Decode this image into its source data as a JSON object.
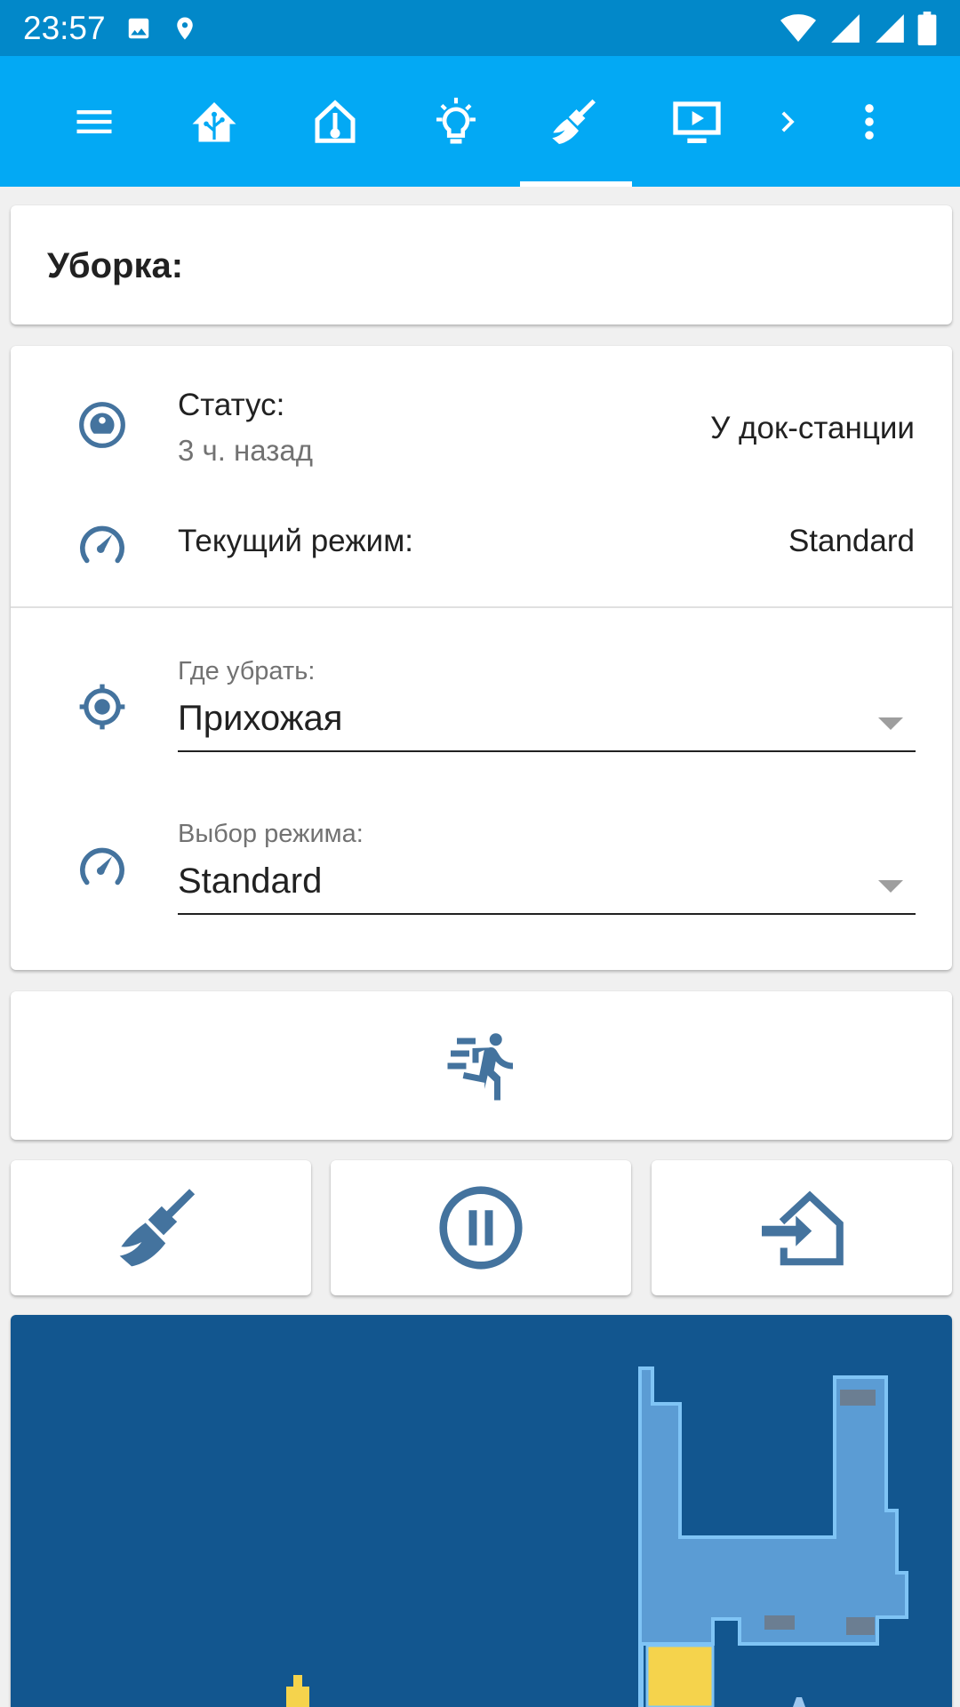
{
  "status_bar": {
    "time": "23:57",
    "left_icons": [
      "image-icon",
      "location-pin-icon"
    ],
    "right_icons": [
      "wifi-icon",
      "signal-icon",
      "signal-icon-2",
      "battery-icon"
    ]
  },
  "toolbar": {
    "icons": [
      "menu-icon",
      "home-assistant-icon",
      "home-thermometer-icon",
      "lightbulb-icon",
      "broom-icon",
      "television-play-icon",
      "chevron-right-icon",
      "more-vert-icon"
    ],
    "active_tab": "broom-icon"
  },
  "title_card": {
    "title": "Уборка:"
  },
  "entities": {
    "status": {
      "label": "Статус:",
      "secondary": "3 ч. назад",
      "value": "У док-станции",
      "icon": "robot-vacuum-icon"
    },
    "mode": {
      "label": "Текущий режим:",
      "value": "Standard",
      "icon": "speedometer-icon"
    },
    "where": {
      "label": "Где убрать:",
      "value": "Прихожая",
      "icon": "crosshairs-gps-icon"
    },
    "mode_select": {
      "label": "Выбор режима:",
      "value": "Standard",
      "icon": "speedometer-icon"
    }
  },
  "buttons": {
    "run": "run-fast-icon",
    "actions": [
      "broom-icon",
      "pause-circle-icon",
      "home-import-icon"
    ]
  },
  "colors": {
    "status_bar": "#0288c9",
    "toolbar": "#03a9f4",
    "icon": "#44739e",
    "map_background": "#12568f",
    "map_floor": "#5b9cd4",
    "map_wall": "#7fc4f5",
    "map_highlight": "#f5d34c"
  }
}
